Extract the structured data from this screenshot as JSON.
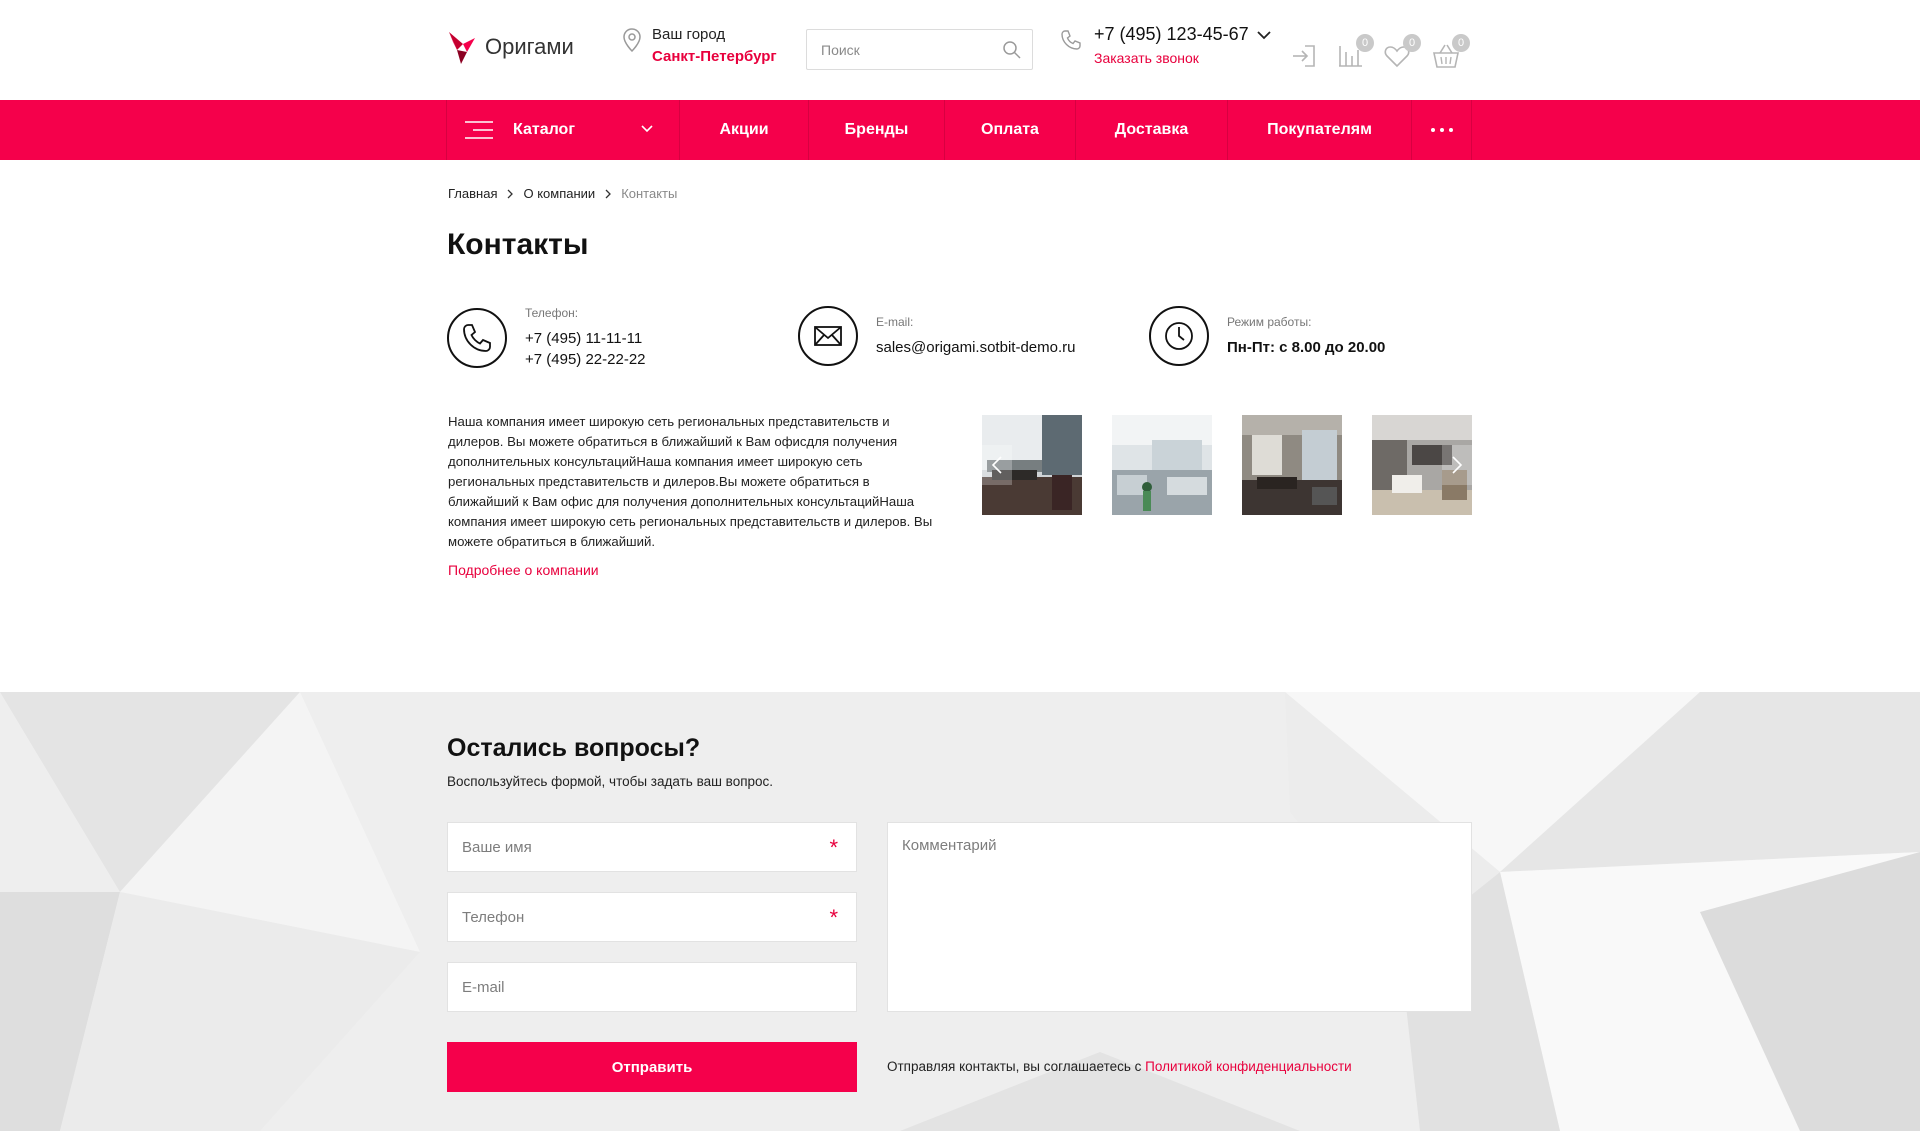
{
  "header": {
    "logo_text": "Оригами",
    "city_label": "Ваш город",
    "city_value": "Санкт-Петербург",
    "search_placeholder": "Поиск",
    "phone": "+7 (495) 123-45-67",
    "callback": "Заказать звонок",
    "icons": [
      {
        "name": "login-icon",
        "badge": ""
      },
      {
        "name": "compare-icon",
        "badge": "0"
      },
      {
        "name": "favorites-icon",
        "badge": "0"
      },
      {
        "name": "cart-icon",
        "badge": "0"
      }
    ]
  },
  "nav": {
    "catalog": "Каталог",
    "items": [
      "Акции",
      "Бренды",
      "Оплата",
      "Доставка",
      "Покупателям"
    ]
  },
  "breadcrumb": [
    "Главная",
    "О компании",
    "Контакты"
  ],
  "page_title": "Контакты",
  "contacts": {
    "phone_label": "Телефон:",
    "phone_1": "+7 (495) 11-11-11",
    "phone_2": "+7 (495) 22-22-22",
    "email_label": "E-mail:",
    "email": "sales@origami.sotbit-demo.ru",
    "hours_label": "Режим работы:",
    "hours": "Пн-Пт: с 8.00 до 20.00"
  },
  "about": {
    "text": "Наша компания имеет широкую сеть региональных представительств и дилеров. Вы можете обратиться в ближайший к Вам офисдля получения дополнительных консультацийНаша компания имеет широкую сеть региональных представительств и дилеров.Вы можете обратиться в ближайший к Вам офис для получения дополнительных консультацийНаша компания имеет широкую сеть региональных представительств и дилеров. Вы можете обратиться в ближайший.",
    "link": "Подробнее о компании"
  },
  "form": {
    "title": "Остались вопросы?",
    "subtitle": "Воспользуйтесь формой, чтобы задать ваш вопрос.",
    "name_placeholder": "Ваше имя",
    "phone_placeholder": "Телефон",
    "email_placeholder": "E-mail",
    "comment_placeholder": "Комментарий",
    "required_mark": "*",
    "submit": "Отправить",
    "policy_text": "Отправляя контакты, вы соглашаетесь с ",
    "policy_link": "Политикой конфиденциальности"
  },
  "colors": {
    "accent": "#f5004b",
    "link": "#e8003d"
  }
}
